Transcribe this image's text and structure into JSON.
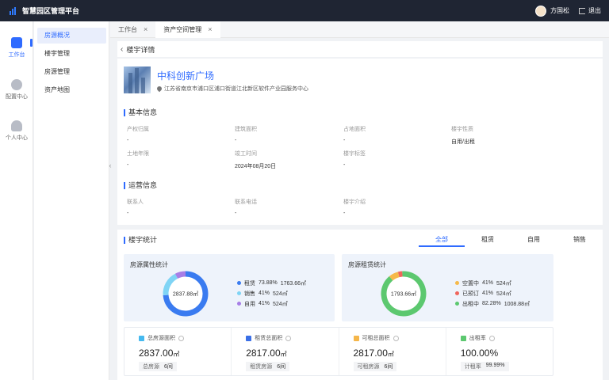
{
  "header": {
    "app_title": "智慧园区管理平台",
    "user_name": "方国松",
    "logout_label": "退出"
  },
  "rail": [
    {
      "label": "工作台",
      "icon": "cube-icon"
    },
    {
      "label": "配置中心",
      "icon": "settings-icon"
    },
    {
      "label": "个人中心",
      "icon": "person-icon"
    }
  ],
  "menu": [
    "房源概况",
    "楼宇管理",
    "房源管理",
    "资产地图"
  ],
  "tabs": [
    {
      "label": "工作台"
    },
    {
      "label": "资产空间管理"
    }
  ],
  "breadcrumb": "楼宇详情",
  "building": {
    "name": "中科创新广场",
    "address": "江苏省南京市浦口区浦口街道江北新区软件产业园服务中心"
  },
  "basic_info": {
    "title": "基本信息",
    "fields": [
      {
        "label": "产权归属",
        "value": "-"
      },
      {
        "label": "建筑面积",
        "value": "-"
      },
      {
        "label": "占地面积",
        "value": "-"
      },
      {
        "label": "楼宇性质",
        "value": "自用/出租"
      },
      {
        "label": "土地年限",
        "value": "-"
      },
      {
        "label": "竣工时间",
        "value": "2024年08月20日"
      },
      {
        "label": "楼宇标签",
        "value": "-"
      }
    ]
  },
  "ops_info": {
    "title": "运营信息",
    "fields": [
      {
        "label": "联系人",
        "value": "-"
      },
      {
        "label": "联系电话",
        "value": "-"
      },
      {
        "label": "楼宇介绍",
        "value": "-"
      }
    ]
  },
  "stats_section": {
    "title": "楼宇统计",
    "filters": [
      "全部",
      "租赁",
      "自用",
      "销售"
    ],
    "active_filter": 0
  },
  "property_card": {
    "title": "房源属性统计",
    "center": "2837.88㎡",
    "segments": [
      {
        "name": "租赁",
        "percent_text": "73.88%",
        "area": "1763.66㎡",
        "fraction": 0.7388,
        "color": "#3a7bf0"
      },
      {
        "name": "销售",
        "percent_text": "41%",
        "area": "524㎡",
        "fraction": 0.185,
        "color": "#7fd4f5"
      },
      {
        "name": "自用",
        "percent_text": "41%",
        "area": "524㎡",
        "fraction": 0.0762,
        "color": "#a77ee6"
      }
    ]
  },
  "lease_card": {
    "title": "房源租赁统计",
    "center": "1793.66㎡",
    "segments": [
      {
        "name": "空置中",
        "percent_text": "41%",
        "area": "524㎡",
        "fraction": 0.07,
        "color": "#f6b94a"
      },
      {
        "name": "已预订",
        "percent_text": "41%",
        "area": "524㎡",
        "fraction": 0.03,
        "color": "#f0655c"
      },
      {
        "name": "出租中",
        "percent_text": "82.28%",
        "area": "1008.88㎡",
        "fraction": 0.9,
        "color": "#5cc86f"
      }
    ]
  },
  "stats": [
    {
      "label": "总房源面积",
      "color": "#45b9ef",
      "value": "2837.00",
      "unit": "㎡",
      "sub_label": "总房源",
      "sub_value": "6间"
    },
    {
      "label": "租赁总面积",
      "color": "#3a6fe6",
      "value": "2817.00",
      "unit": "㎡",
      "sub_label": "租赁房源",
      "sub_value": "6间"
    },
    {
      "label": "可租总面积",
      "color": "#f5b64a",
      "value": "2817.00",
      "unit": "㎡",
      "sub_label": "可租房源",
      "sub_value": "6间"
    },
    {
      "label": "出租率",
      "color": "#5cc86f",
      "value": "100.00%",
      "unit": "",
      "sub_label": "计租率",
      "sub_value": "99.99%"
    }
  ]
}
